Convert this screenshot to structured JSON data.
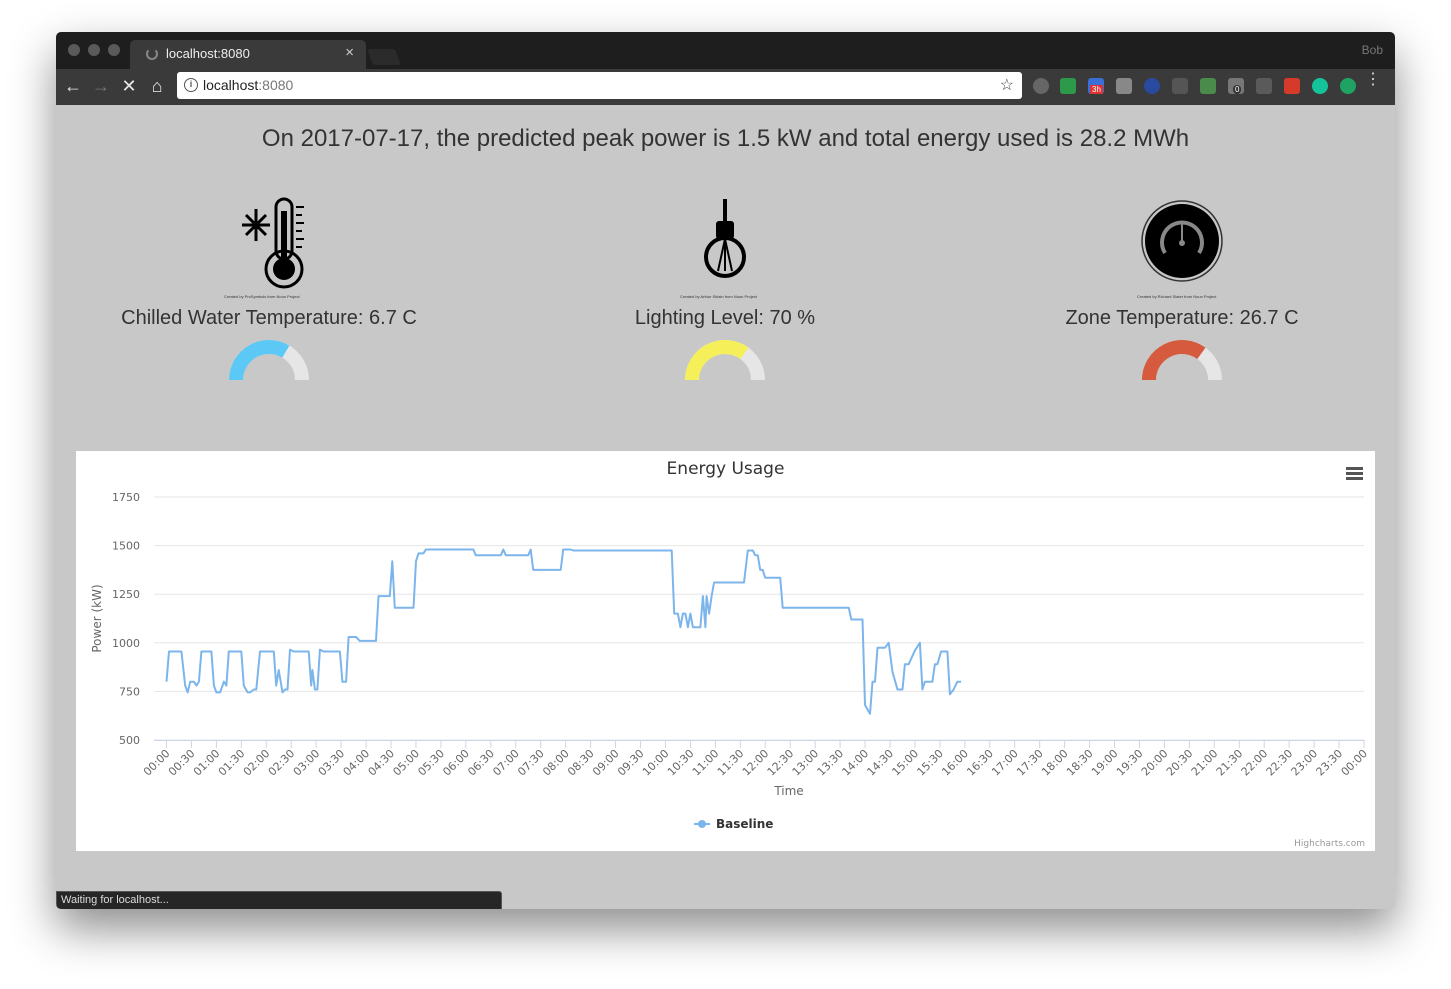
{
  "browser": {
    "tab_title": "localhost:8080",
    "tab_close": "×",
    "profile_name": "Bob",
    "url_host": "localhost",
    "url_port": ":8080",
    "status_text": "Waiting for localhost...",
    "extension_badges": [
      "3h",
      "0"
    ]
  },
  "headline": "On 2017-07-17, the predicted peak power is 1.5 kW and total energy used is 28.2 MWh",
  "metrics": [
    {
      "label": "Chilled Water Temperature: 6.7 C",
      "icon": "thermometer-snowflake-icon",
      "credit": "Created by ProSymbols from Noun Project",
      "gauge_fraction": 0.67,
      "gauge_color": "#5bc8f5"
    },
    {
      "label": "Lighting Level: 70 %",
      "icon": "light-bulb-icon",
      "credit": "Created by Arthur Shlain from Noun Project",
      "gauge_fraction": 0.7,
      "gauge_color": "#f5f05a"
    },
    {
      "label": "Zone Temperature: 26.7 C",
      "icon": "gauge-dial-icon",
      "credit": "Created by Richard Slater from Noun Project",
      "gauge_fraction": 0.7,
      "gauge_color": "#d65a3e"
    }
  ],
  "chart_data": {
    "type": "line",
    "title": "Energy Usage",
    "xlabel": "Time",
    "ylabel": "Power (kW)",
    "ylim": [
      500,
      1750
    ],
    "yticks": [
      500,
      750,
      1000,
      1250,
      1500,
      1750
    ],
    "grid": true,
    "legend": "bottom-center",
    "credit": "Highcharts.com",
    "categories": [
      "00:00",
      "00:30",
      "01:00",
      "01:30",
      "02:00",
      "02:30",
      "03:00",
      "03:30",
      "04:00",
      "04:30",
      "05:00",
      "05:30",
      "06:00",
      "06:30",
      "07:00",
      "07:30",
      "08:00",
      "08:30",
      "09:00",
      "09:30",
      "10:00",
      "10:30",
      "11:00",
      "11:30",
      "12:00",
      "12:30",
      "13:00",
      "13:30",
      "14:00",
      "14:30",
      "15:00",
      "15:30",
      "16:00",
      "16:30",
      "17:00",
      "17:30",
      "18:00",
      "18:30",
      "19:00",
      "19:30",
      "20:00",
      "20:30",
      "21:00",
      "21:30",
      "22:00",
      "22:30",
      "23:00",
      "23:30",
      "00:00"
    ],
    "series": [
      {
        "name": "Baseline",
        "color": "#7cb5ec",
        "points": [
          [
            0,
            800
          ],
          [
            0.1,
            955
          ],
          [
            0.6,
            955
          ],
          [
            0.75,
            780
          ],
          [
            0.85,
            745
          ],
          [
            0.95,
            800
          ],
          [
            1.1,
            800
          ],
          [
            1.2,
            780
          ],
          [
            1.3,
            800
          ],
          [
            1.4,
            955
          ],
          [
            1.8,
            955
          ],
          [
            1.9,
            780
          ],
          [
            2.0,
            745
          ],
          [
            2.15,
            745
          ],
          [
            2.3,
            800
          ],
          [
            2.4,
            780
          ],
          [
            2.5,
            955
          ],
          [
            3.0,
            955
          ],
          [
            3.1,
            780
          ],
          [
            3.25,
            745
          ],
          [
            3.35,
            745
          ],
          [
            3.5,
            760
          ],
          [
            3.6,
            760
          ],
          [
            3.75,
            955
          ],
          [
            4.3,
            955
          ],
          [
            4.4,
            780
          ],
          [
            4.5,
            860
          ],
          [
            4.65,
            745
          ],
          [
            4.75,
            760
          ],
          [
            4.85,
            760
          ],
          [
            4.95,
            965
          ],
          [
            5.1,
            955
          ],
          [
            5.7,
            955
          ],
          [
            5.8,
            780
          ],
          [
            5.85,
            860
          ],
          [
            5.95,
            760
          ],
          [
            6.05,
            760
          ],
          [
            6.15,
            965
          ],
          [
            6.3,
            955
          ],
          [
            6.95,
            955
          ],
          [
            7.05,
            800
          ],
          [
            7.2,
            800
          ],
          [
            7.3,
            1030
          ],
          [
            7.6,
            1030
          ],
          [
            7.75,
            1010
          ],
          [
            8.4,
            1010
          ],
          [
            8.5,
            1240
          ],
          [
            8.95,
            1240
          ],
          [
            9.05,
            1420
          ],
          [
            9.15,
            1180
          ],
          [
            9.9,
            1180
          ],
          [
            10.0,
            1420
          ],
          [
            10.1,
            1460
          ],
          [
            10.3,
            1460
          ],
          [
            10.4,
            1480
          ],
          [
            12.3,
            1480
          ],
          [
            12.4,
            1450
          ],
          [
            13.4,
            1450
          ],
          [
            13.5,
            1480
          ],
          [
            13.6,
            1450
          ],
          [
            14.5,
            1450
          ],
          [
            14.6,
            1480
          ],
          [
            14.7,
            1375
          ],
          [
            15.8,
            1375
          ],
          [
            15.9,
            1480
          ],
          [
            16.2,
            1480
          ],
          [
            16.3,
            1475
          ],
          [
            20.25,
            1475
          ],
          [
            20.35,
            1150
          ],
          [
            20.5,
            1150
          ],
          [
            20.6,
            1080
          ],
          [
            20.7,
            1150
          ],
          [
            20.8,
            1150
          ],
          [
            20.9,
            1080
          ],
          [
            21.0,
            1150
          ],
          [
            21.1,
            1080
          ],
          [
            21.4,
            1080
          ],
          [
            21.5,
            1240
          ],
          [
            21.6,
            1080
          ],
          [
            21.65,
            1240
          ],
          [
            21.75,
            1150
          ],
          [
            21.85,
            1240
          ],
          [
            21.95,
            1310
          ],
          [
            23.15,
            1310
          ],
          [
            23.3,
            1475
          ],
          [
            23.5,
            1475
          ],
          [
            23.6,
            1450
          ],
          [
            23.7,
            1450
          ],
          [
            23.8,
            1375
          ],
          [
            23.9,
            1375
          ],
          [
            24.0,
            1335
          ],
          [
            24.6,
            1335
          ],
          [
            24.7,
            1180
          ],
          [
            27.35,
            1180
          ],
          [
            27.45,
            1120
          ],
          [
            27.9,
            1120
          ],
          [
            28.0,
            680
          ],
          [
            28.2,
            635
          ],
          [
            28.3,
            800
          ],
          [
            28.4,
            800
          ],
          [
            28.5,
            975
          ],
          [
            28.8,
            975
          ],
          [
            28.95,
            1000
          ],
          [
            29.1,
            850
          ],
          [
            29.3,
            760
          ],
          [
            29.5,
            760
          ],
          [
            29.6,
            890
          ],
          [
            29.75,
            890
          ],
          [
            30.0,
            960
          ],
          [
            30.2,
            1000
          ],
          [
            30.3,
            760
          ],
          [
            30.4,
            800
          ],
          [
            30.7,
            800
          ],
          [
            30.8,
            890
          ],
          [
            30.9,
            890
          ],
          [
            31.05,
            955
          ],
          [
            31.3,
            955
          ],
          [
            31.4,
            735
          ],
          [
            31.55,
            760
          ],
          [
            31.7,
            800
          ],
          [
            31.85,
            800
          ]
        ]
      }
    ]
  }
}
